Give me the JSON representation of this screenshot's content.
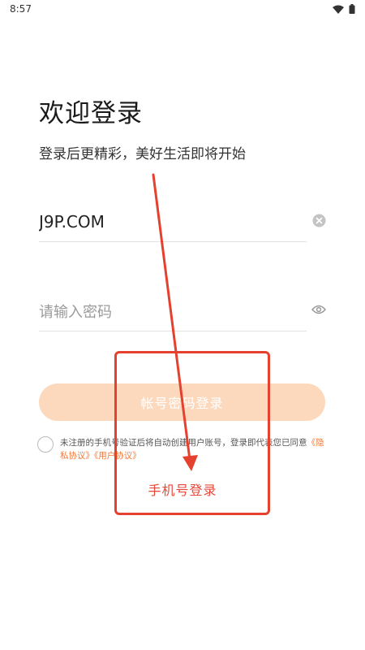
{
  "status_bar": {
    "time": "8:57"
  },
  "login": {
    "title": "欢迎登录",
    "subtitle": "登录后更精彩，美好生活即将开始",
    "account_value": "J9P.COM",
    "password_placeholder": "请输入密码",
    "submit_label": "帐号密码登录",
    "agreement_text": "未注册的手机号验证后将自动创建用户账号，登录即代表您已同意",
    "privacy_link": "《隐私协议》",
    "user_link": "《用户协议》",
    "phone_login_label": "手机号登录"
  },
  "icons": {
    "clear": "clear-circle-icon",
    "visibility": "eye-icon",
    "wifi": "wifi-icon",
    "battery": "battery-icon"
  },
  "colors": {
    "primary_button": "#fcd9bd",
    "link": "#f07a3a",
    "phone_login": "#e8483a",
    "annotation": "#e5412f"
  }
}
